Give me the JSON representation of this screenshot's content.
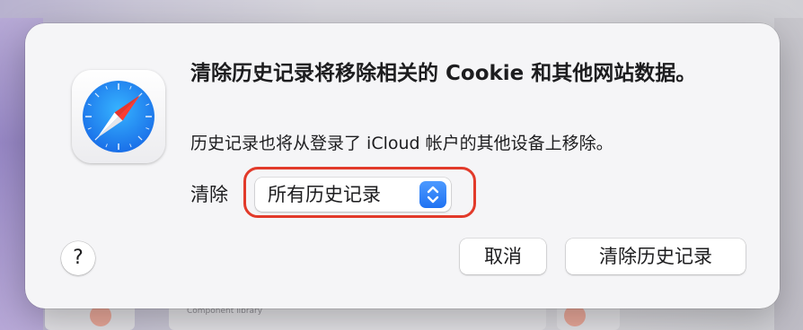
{
  "dialog": {
    "title": "清除历史记录将移除相关的 Cookie 和其他网站数据。",
    "message": "历史记录也将从登录了 iCloud 帐户的其他设备上移除。",
    "clear_label": "清除",
    "range_select": {
      "value": "所有历史记录"
    },
    "cancel_button": "取消",
    "confirm_button": "清除历史记录",
    "help_button": "?"
  },
  "background": {
    "caption": "Component library"
  },
  "colors": {
    "accent": "#1f72f2",
    "highlight": "#e23a2a",
    "dialog_bg": "#f5f5f7"
  },
  "icons": {
    "app_icon": "safari-compass-icon",
    "popup_arrows": "up-down-chevron-icon"
  }
}
